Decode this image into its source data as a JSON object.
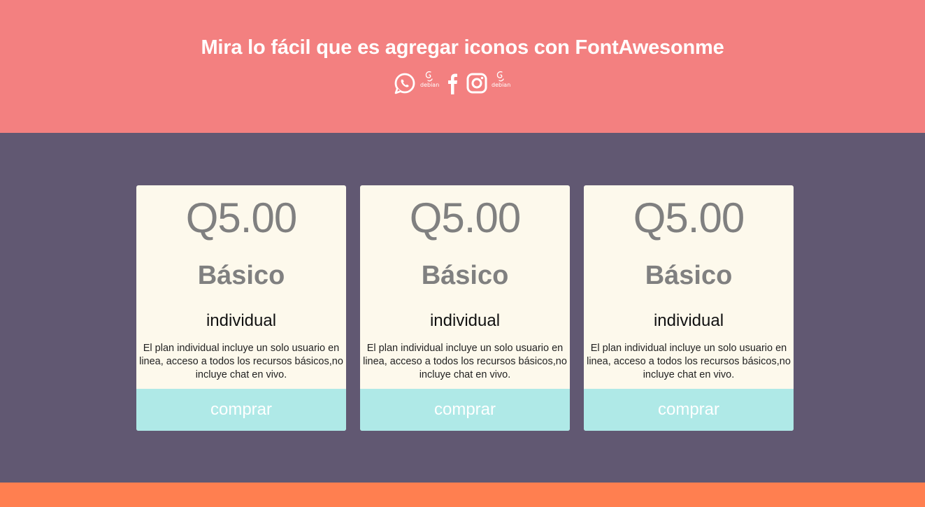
{
  "header": {
    "title": "Mira lo fácil que es agregar iconos con FontAwesonme",
    "background": "#f38080",
    "icons": [
      {
        "name": "whatsapp-icon"
      },
      {
        "name": "debian-icon",
        "label": "debian"
      },
      {
        "name": "facebook-icon"
      },
      {
        "name": "instagram-icon"
      },
      {
        "name": "debian-icon",
        "label": "debian"
      }
    ]
  },
  "main": {
    "background": "#615872"
  },
  "plans": [
    {
      "price": "Q5.00",
      "name": "Básico",
      "type": "individual",
      "description": "El plan individual incluye un solo usuario en linea, acceso a todos los recursos básicos,no incluye chat en vivo.",
      "button": "comprar"
    },
    {
      "price": "Q5.00",
      "name": "Básico",
      "type": "individual",
      "description": "El plan individual incluye un solo usuario en linea, acceso a todos los recursos básicos,no incluye chat en vivo.",
      "button": "comprar"
    },
    {
      "price": "Q5.00",
      "name": "Básico",
      "type": "individual",
      "description": "El plan individual incluye un solo usuario en linea, acceso a todos los recursos básicos,no incluye chat en vivo.",
      "button": "comprar"
    }
  ],
  "colors": {
    "card_background": "#fdf9ec",
    "button_background": "#afe9e7",
    "footer_background": "#ff7f50"
  }
}
